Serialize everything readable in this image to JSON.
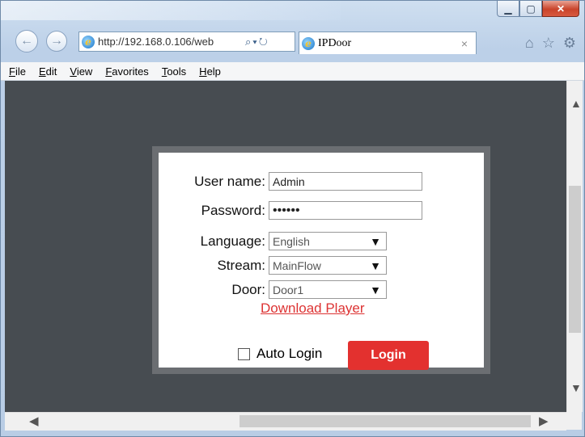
{
  "browser": {
    "url": "http://192.168.0.106/web",
    "url_search_icon": "search-icon",
    "tab_title": "IPDoor",
    "tab_close": "×",
    "icons": [
      "home-icon",
      "star-icon",
      "gear-icon"
    ]
  },
  "menubar": {
    "items": [
      "File",
      "Edit",
      "View",
      "Favorites",
      "Tools",
      "Help"
    ]
  },
  "login": {
    "username_label": "User name:",
    "username_value": "Admin",
    "password_label": "Password:",
    "password_value": "••••••",
    "language_label": "Language:",
    "language_value": "English",
    "stream_label": "Stream:",
    "stream_value": "MainFlow",
    "door_label": "Door:",
    "door_value": "Door1",
    "download_link": "Download Player",
    "auto_login_label": "Auto Login",
    "login_button": "Login"
  },
  "colors": {
    "content_bg": "#474c51",
    "login_button": "#e3312f",
    "download_link": "#d33333"
  }
}
